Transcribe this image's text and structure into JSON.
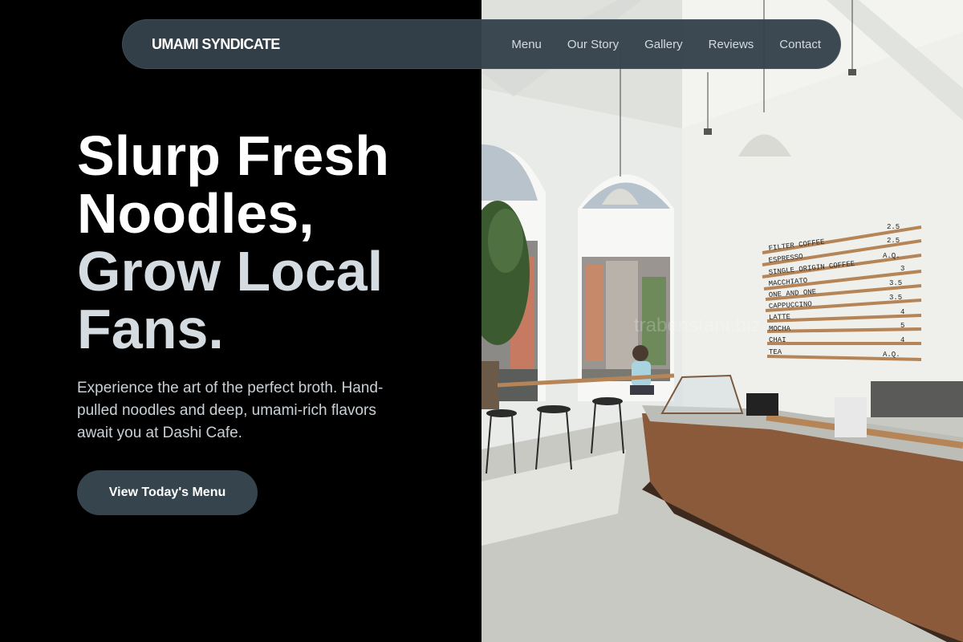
{
  "brand": "UMAMI SYNDICATE",
  "nav": [
    {
      "label": "Menu"
    },
    {
      "label": "Our Story"
    },
    {
      "label": "Gallery"
    },
    {
      "label": "Reviews"
    },
    {
      "label": "Contact"
    }
  ],
  "hero": {
    "title_lines": [
      "Slurp Fresh",
      "Noodles,",
      "Grow Local",
      "Fans."
    ],
    "subtitle": "Experience the art of the perfect broth. Hand-pulled noodles and deep, umami-rich flavors await you at Dashi Cafe.",
    "cta": "View Today's Menu"
  },
  "image": {
    "menu_board": [
      {
        "item": "FILTER COFFEE",
        "price": "2.5"
      },
      {
        "item": "ESPRESSO",
        "price": "2.5"
      },
      {
        "item": "SINGLE ORIGIN COFFEE",
        "price": "A.Q."
      },
      {
        "item": "MACCHIATO",
        "price": "3"
      },
      {
        "item": "ONE AND ONE",
        "price": "3.5"
      },
      {
        "item": "CAPPUCCINO",
        "price": "3.5"
      },
      {
        "item": "LATTE",
        "price": "4"
      },
      {
        "item": "MOCHA",
        "price": "5"
      },
      {
        "item": "CHAI",
        "price": "4"
      },
      {
        "item": "TEA",
        "price": "A.Q."
      }
    ],
    "watermark": "trabenstant.biz"
  },
  "colors": {
    "background": "#000000",
    "nav_bg": "#34424b",
    "accent_text": "#d5dce1",
    "cta_bg": "#35444d"
  }
}
